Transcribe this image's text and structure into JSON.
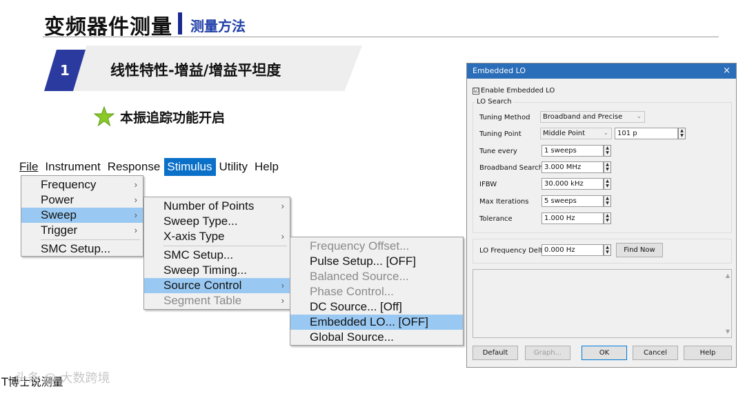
{
  "slide": {
    "title": "变频器件测量",
    "subtitle": "测量方法",
    "section_number": "1",
    "section_title": "线性特性-增益/增益平坦度",
    "bullet": "本振追踪功能开启",
    "watermark_prefix": "T",
    "watermark_text": "博士说测量",
    "watermark_overlay": "头条 @ 大数跨境"
  },
  "menubar": {
    "items": [
      "File",
      "Instrument",
      "Response",
      "Stimulus",
      "Utility",
      "Help"
    ],
    "active": "Stimulus"
  },
  "menu_stimulus": {
    "items": [
      {
        "label": "Frequency",
        "arrow": "›"
      },
      {
        "label": "Power",
        "arrow": "›"
      },
      {
        "label": "Sweep",
        "arrow": "›"
      },
      {
        "label": "Trigger",
        "arrow": "›"
      },
      {
        "label": "SMC Setup...",
        "arrow": ""
      }
    ]
  },
  "menu_sweep": {
    "items": [
      {
        "label": "Number of Points",
        "arrow": "›"
      },
      {
        "label": "Sweep Type...",
        "arrow": ""
      },
      {
        "label": "X-axis Type",
        "arrow": "›"
      },
      {
        "label": "SMC Setup...",
        "arrow": ""
      },
      {
        "label": "Sweep Timing...",
        "arrow": ""
      },
      {
        "label": "Source Control",
        "arrow": "›"
      },
      {
        "label": "Segment Table",
        "arrow": "›"
      }
    ]
  },
  "menu_source": {
    "items": [
      {
        "label": "Frequency Offset..."
      },
      {
        "label": "Pulse Setup... [OFF]"
      },
      {
        "label": "Balanced Source..."
      },
      {
        "label": "Phase Control..."
      },
      {
        "label": "DC Source... [Off]"
      },
      {
        "label": "Embedded LO... [OFF]"
      },
      {
        "label": "Global Source..."
      }
    ]
  },
  "dialog": {
    "title": "Embedded LO",
    "close": "×",
    "enable_label": "Enable Embedded LO",
    "enable_checked": "☑",
    "group_label": "LO Search",
    "tuning_method_label": "Tuning Method",
    "tuning_method_value": "Broadband and Precise",
    "tuning_point_label": "Tuning Point",
    "tuning_point_value": "Middle Point",
    "tuning_point_count": "101 p",
    "tune_every_label": "Tune every",
    "tune_every_value": "1 sweeps",
    "broadband_search_label": "Broadband Search",
    "broadband_search_value": "3.000 MHz",
    "ifbw_label": "IFBW",
    "ifbw_value": "30.000 kHz",
    "max_iterations_label": "Max Iterations",
    "max_iterations_value": "5 sweeps",
    "tolerance_label": "Tolerance",
    "tolerance_value": "1.000 Hz",
    "lo_delta_label": "LO Frequency Delta",
    "lo_delta_value": "0.000 Hz",
    "find_now": "Find Now",
    "buttons": {
      "default": "Default",
      "graph": "Graph...",
      "ok": "OK",
      "cancel": "Cancel",
      "help": "Help"
    }
  }
}
